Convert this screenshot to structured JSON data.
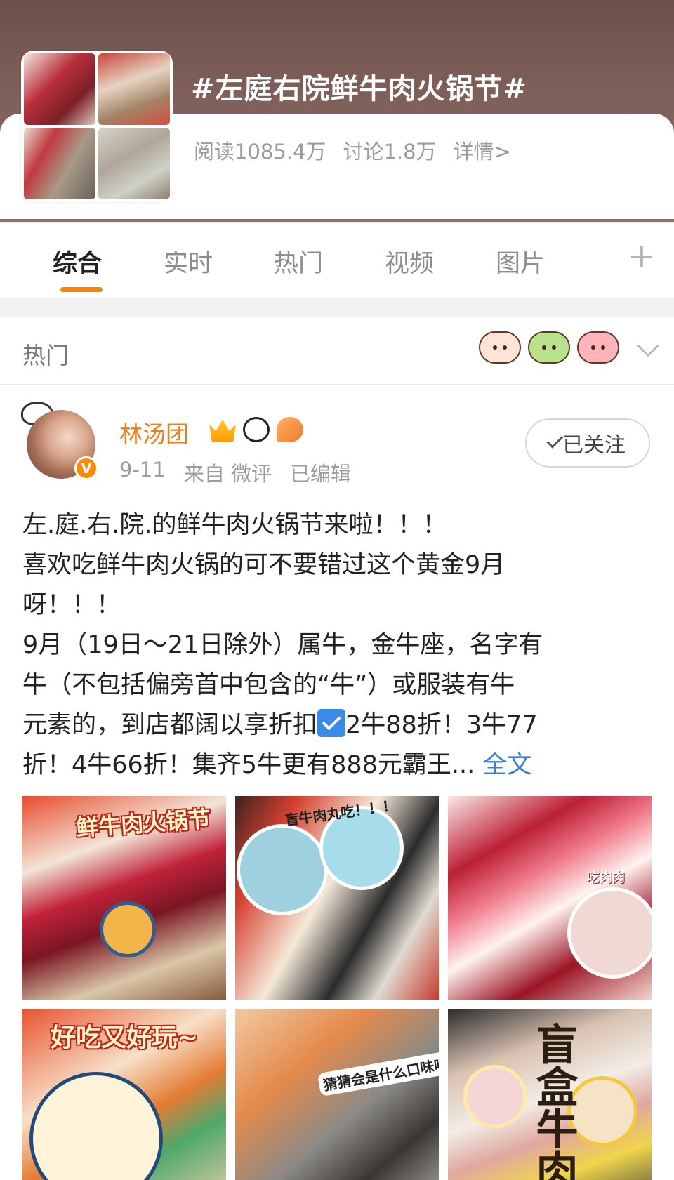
{
  "topic": {
    "title": "#左庭右院鲜牛肉火锅节#",
    "reads": "阅读1085.4万",
    "discussions": "讨论1.8万",
    "details": "详情>"
  },
  "tabs": [
    {
      "label": "综合",
      "active": true
    },
    {
      "label": "实时",
      "active": false
    },
    {
      "label": "热门",
      "active": false
    },
    {
      "label": "视频",
      "active": false
    },
    {
      "label": "图片",
      "active": false
    }
  ],
  "section": {
    "label": "热门",
    "stickers": [
      "bird-sticker-icon",
      "frog-sticker-icon",
      "pig-sticker-icon"
    ]
  },
  "post": {
    "author": "林汤团",
    "verified_badge": "V",
    "date": "9-11",
    "source": "来自 微评",
    "edited": "已编辑",
    "follow_label": "已关注",
    "lines": [
      "左.庭.右.院.的鲜牛肉火锅节来啦！！！",
      "喜欢吃鲜牛肉火锅的可不要错过这个黄金9月",
      "呀！！！",
      "9月（19日～21日除外）属牛，金牛座，名字有",
      "牛（不包括偏旁首中包含的“牛”）或服装有牛"
    ],
    "line6_before": "元素的，到店都阔以享折扣",
    "line6_after": "2牛88折！3牛77",
    "line7": "折！4牛66折！集齐5牛更有888元霸王...",
    "full_text_link": "全文"
  },
  "images": {
    "captions": [
      "鲜牛肉火锅节",
      "盲牛肉丸吃！！！",
      "吃肉肉",
      "好吃又好玩~",
      "猜猜会是什么口味呢？",
      "盲盒牛肉"
    ]
  },
  "colors": {
    "accent_orange": "#ff8200",
    "author_orange": "#ef7d1a",
    "link_blue": "#3b7fd4"
  }
}
